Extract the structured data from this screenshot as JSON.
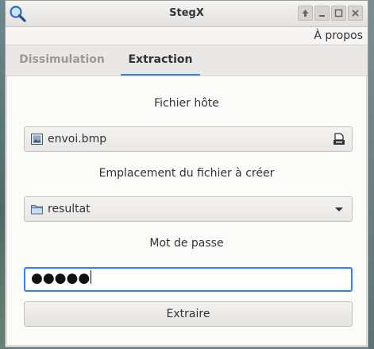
{
  "window": {
    "title": "StegX",
    "app_icon": "magnifier-icon",
    "controls": [
      "arrow-up-icon",
      "minimize-icon",
      "maximize-icon",
      "close-icon"
    ]
  },
  "menu": {
    "about": "À propos"
  },
  "tabs": [
    {
      "label": "Dissimulation",
      "active": false
    },
    {
      "label": "Extraction",
      "active": true
    }
  ],
  "extraction": {
    "host_file_label": "Fichier hôte",
    "host_file_value": "envoi.bmp",
    "host_file_icon": "image-file-icon",
    "host_file_button_icon": "file-open-icon",
    "output_label": "Emplacement du fichier à créer",
    "output_value": "resultat",
    "output_icon": "folder-icon",
    "password_label": "Mot de passe",
    "password_value": "●●●●●",
    "extract_button": "Extraire"
  },
  "colors": {
    "accent": "#3584e4"
  }
}
